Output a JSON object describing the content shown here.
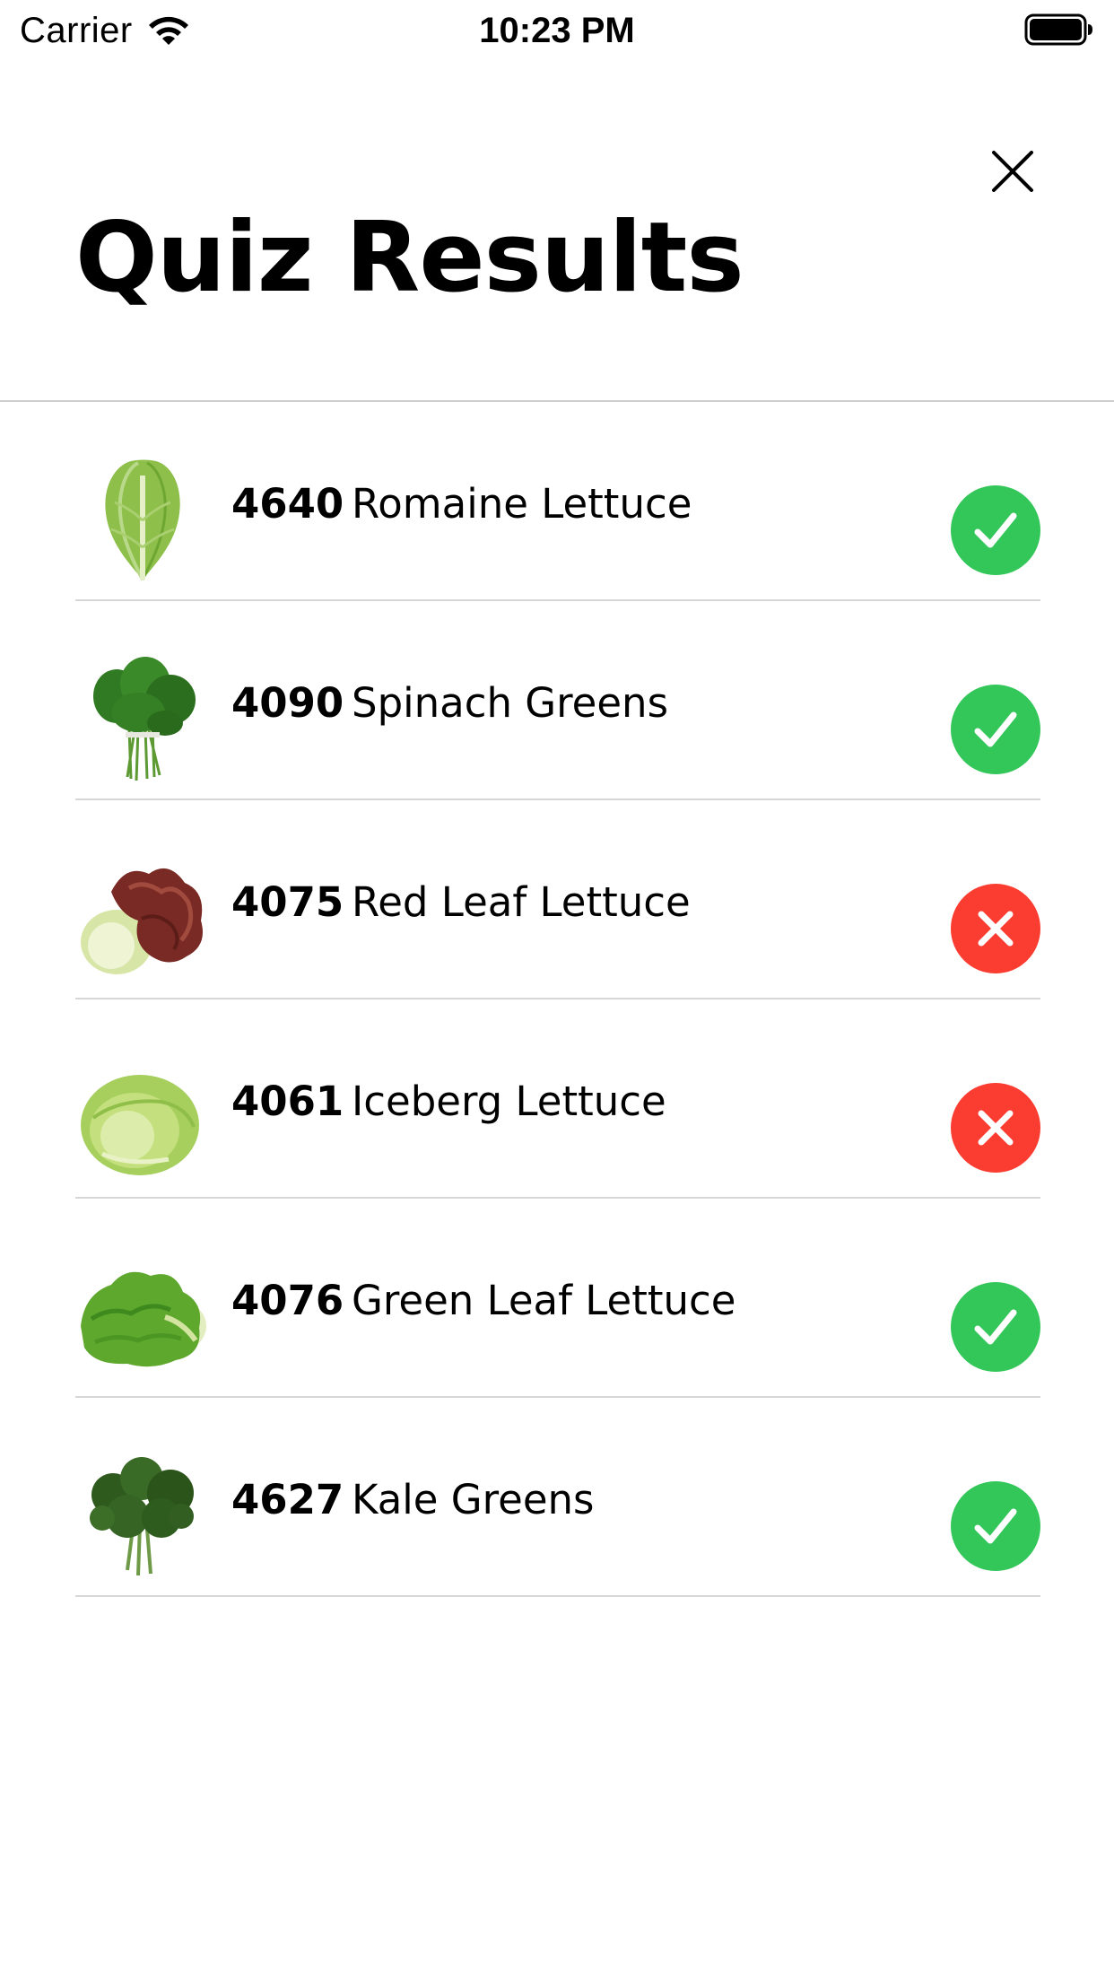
{
  "status_bar": {
    "carrier": "Carrier",
    "time": "10:23 PM",
    "wifi_icon": "wifi-icon",
    "battery_icon": "battery-icon"
  },
  "header": {
    "title": "Quiz Results",
    "close_icon": "close-icon"
  },
  "colors": {
    "correct": "#33c659",
    "incorrect": "#fb3c31",
    "divider": "#d6d6d6"
  },
  "results": [
    {
      "plu": "4640",
      "name": "Romaine Lettuce",
      "correct": true,
      "image": "romaine-lettuce-image"
    },
    {
      "plu": "4090",
      "name": "Spinach Greens",
      "correct": true,
      "image": "spinach-greens-image"
    },
    {
      "plu": "4075",
      "name": "Red Leaf Lettuce",
      "correct": false,
      "image": "red-leaf-lettuce-image"
    },
    {
      "plu": "4061",
      "name": "Iceberg Lettuce",
      "correct": false,
      "image": "iceberg-lettuce-image"
    },
    {
      "plu": "4076",
      "name": "Green Leaf Lettuce",
      "correct": true,
      "image": "green-leaf-lettuce-image"
    },
    {
      "plu": "4627",
      "name": "Kale Greens",
      "correct": true,
      "image": "kale-greens-image"
    }
  ]
}
